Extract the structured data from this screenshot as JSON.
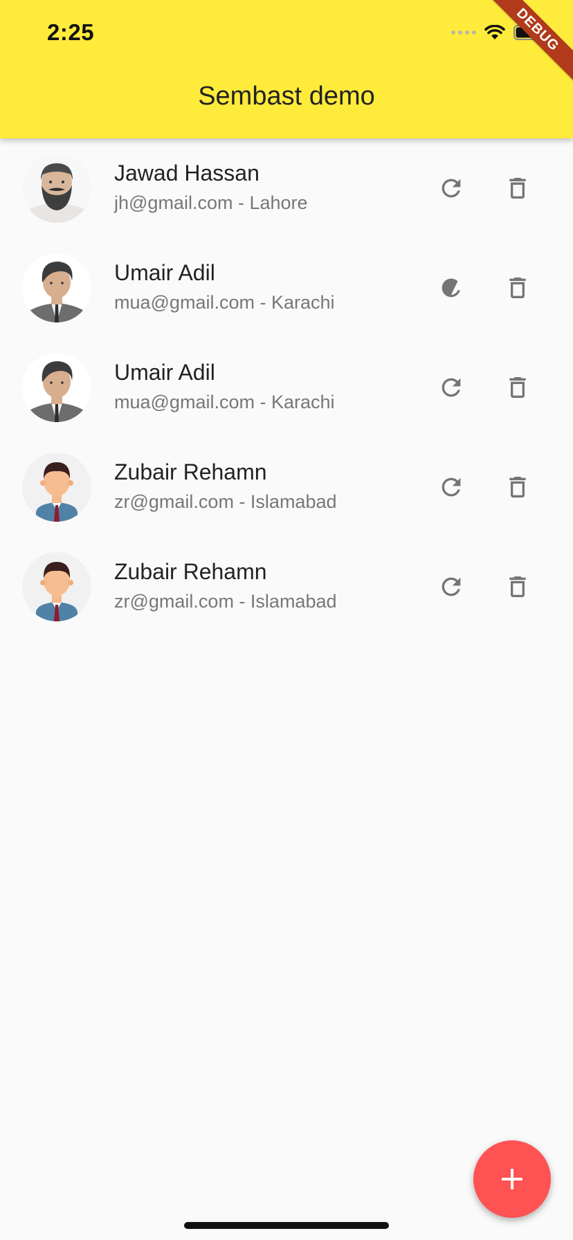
{
  "status_bar": {
    "time": "2:25"
  },
  "debug_banner": {
    "label": "DEBUG"
  },
  "app_bar": {
    "title": "Sembast demo"
  },
  "colors": {
    "app_bar": "#ffeb3b",
    "fab": "#ff5252",
    "icon_gray": "#757575",
    "background": "#fafafa"
  },
  "records": [
    {
      "name": "Jawad Hassan",
      "subtitle": "jh@gmail.com - Lahore",
      "avatar": "bearded-man-avatar"
    },
    {
      "name": "Umair Adil",
      "subtitle": "mua@gmail.com - Karachi",
      "avatar": "suit-man-avatar"
    },
    {
      "name": "Umair Adil",
      "subtitle": "mua@gmail.com - Karachi",
      "avatar": "suit-man-avatar"
    },
    {
      "name": "Zubair Rehamn",
      "subtitle": "zr@gmail.com - Islamabad",
      "avatar": "businessman-avatar"
    },
    {
      "name": "Zubair Rehamn",
      "subtitle": "zr@gmail.com - Islamabad",
      "avatar": "businessman-avatar"
    }
  ],
  "icons": {
    "row_actions": [
      "refresh-icon",
      "delete-icon"
    ],
    "fab": "add-icon"
  }
}
